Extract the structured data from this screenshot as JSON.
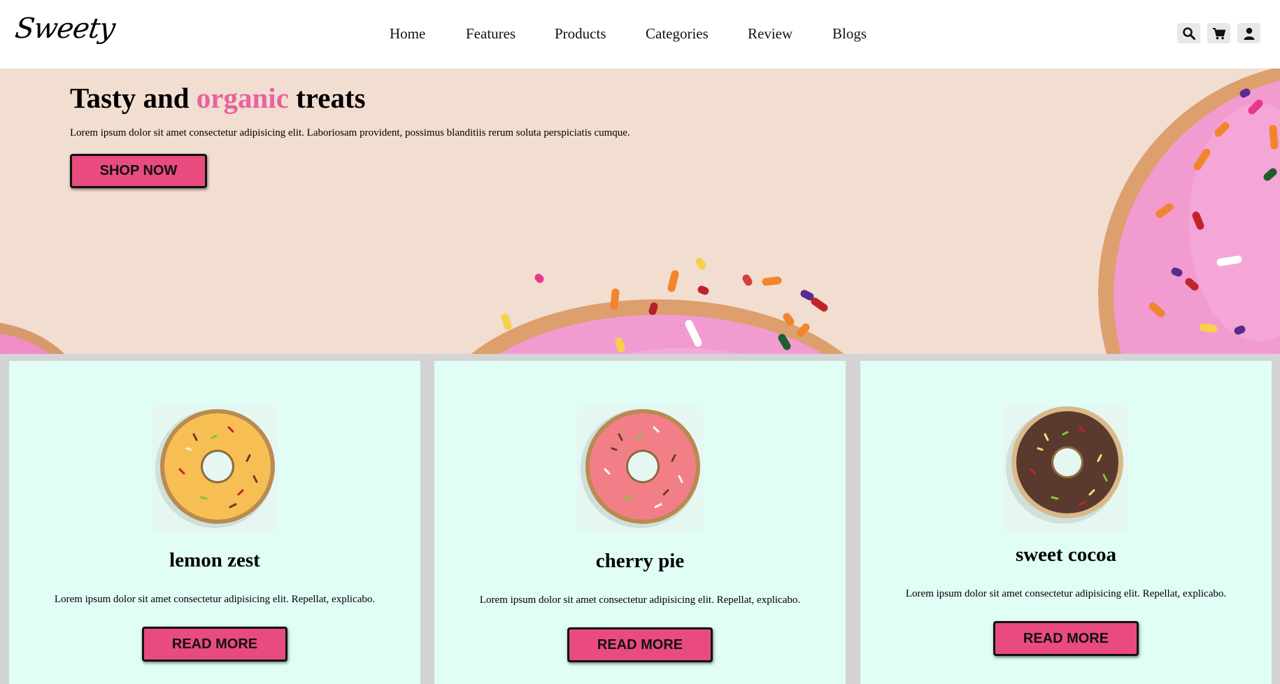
{
  "header": {
    "logo": "Sweety",
    "nav": [
      "Home",
      "Features",
      "Products",
      "Categories",
      "Review",
      "Blogs"
    ],
    "icons": [
      "search-icon",
      "cart-icon",
      "user-icon"
    ]
  },
  "hero": {
    "title_before": "Tasty and ",
    "title_accent": "organic",
    "title_after": " treats",
    "text": "Lorem ipsum dolor sit amet consectetur adipisicing elit. Laboriosam provident, possimus blanditiis rerum soluta perspiciatis cumque.",
    "button": "SHOP NOW"
  },
  "cards": [
    {
      "title": "lemon zest",
      "text": "Lorem ipsum dolor sit amet consectetur adipisicing elit. Repellat, explicabo.",
      "button": "READ MORE",
      "icing_color": "#f7bf53"
    },
    {
      "title": "cherry pie",
      "text": "Lorem ipsum dolor sit amet consectetur adipisicing elit. Repellat, explicabo.",
      "button": "READ MORE",
      "icing_color": "#f27f87"
    },
    {
      "title": "sweet cocoa",
      "text": "Lorem ipsum dolor sit amet consectetur adipisicing elit. Repellat, explicabo.",
      "button": "READ MORE",
      "icing_color": "#5a3a2e"
    }
  ],
  "colors": {
    "accent": "#e8629f",
    "button": "#e94b7e",
    "hero_bg": "#f2ddd1",
    "card_bg": "#e0fdf6"
  }
}
